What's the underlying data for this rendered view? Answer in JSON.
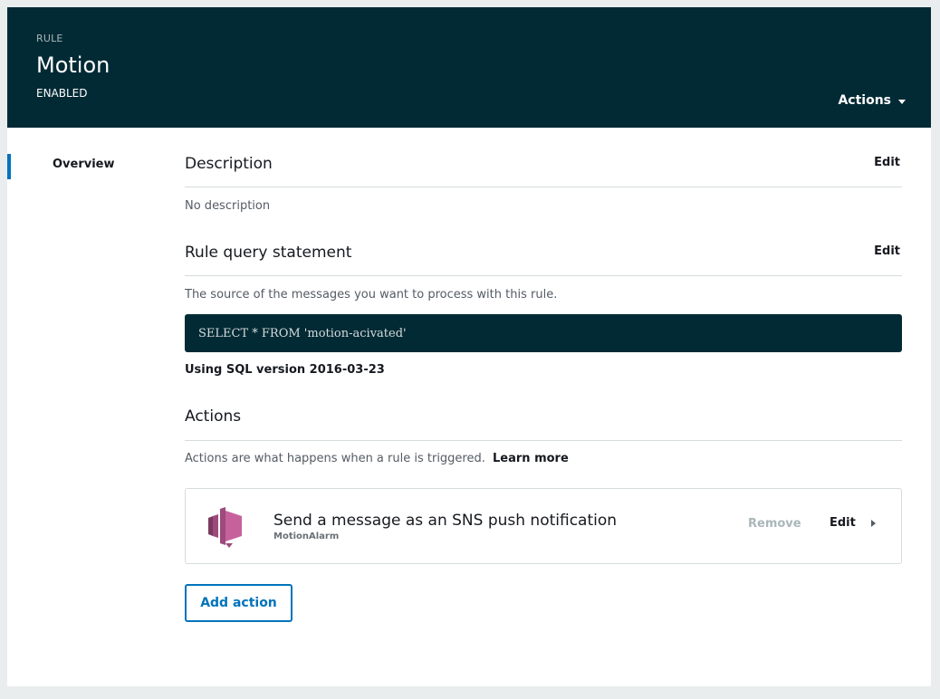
{
  "header": {
    "label": "RULE",
    "title": "Motion",
    "status": "ENABLED",
    "actions_label": "Actions"
  },
  "nav": {
    "items": [
      {
        "label": "Overview",
        "active": true
      }
    ]
  },
  "description": {
    "title": "Description",
    "edit_label": "Edit",
    "text": "No description"
  },
  "query": {
    "title": "Rule query statement",
    "edit_label": "Edit",
    "help_text": "The source of the messages you want to process with this rule.",
    "sql": "SELECT * FROM 'motion-acivated'",
    "version_text": "Using SQL version 2016-03-23"
  },
  "actions": {
    "title": "Actions",
    "help_text": "Actions are what happens when a rule is triggered.",
    "learn_more": "Learn more",
    "items": [
      {
        "icon": "sns-icon",
        "title": "Send a message as an SNS push notification",
        "subtitle": "MotionAlarm",
        "remove_label": "Remove",
        "edit_label": "Edit"
      }
    ],
    "add_label": "Add action"
  },
  "colors": {
    "header_bg": "#012a35",
    "accent": "#0073bb",
    "sns_pink": "#c7619c"
  }
}
